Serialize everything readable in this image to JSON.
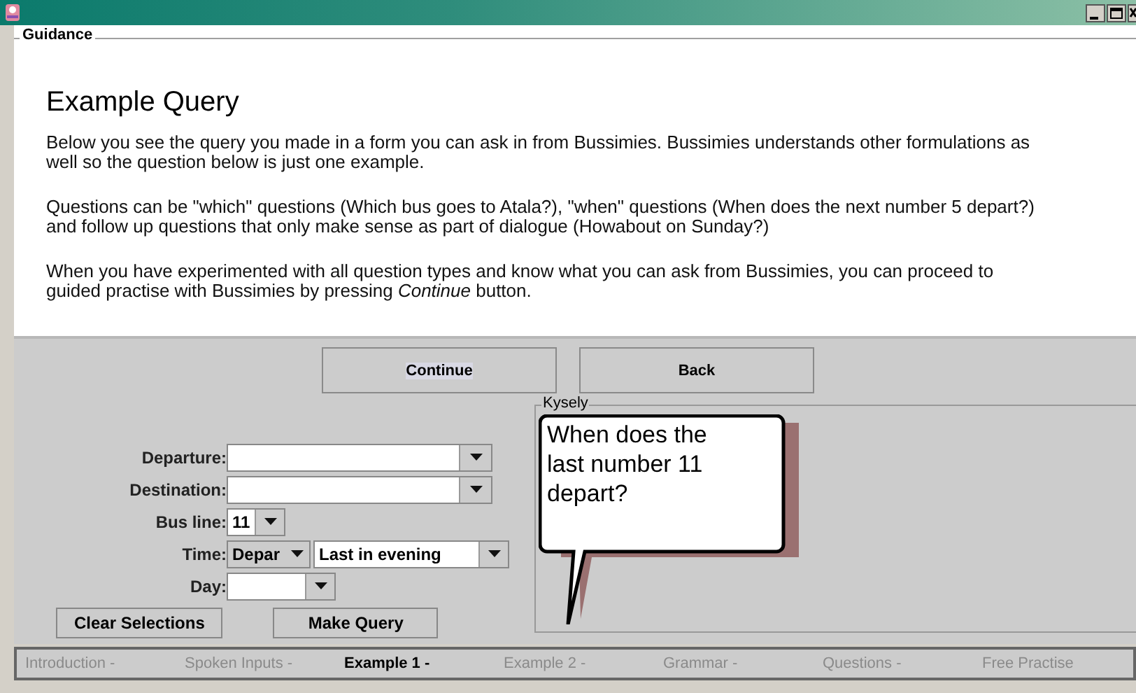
{
  "guidance": {
    "title": "Guidance",
    "heading": "Example Query",
    "paragraphs": [
      "Below you see the query you made in a form you can ask in from Bussimies. Bussimies understands other formulations as well so the question below is just one example.",
      "Questions can be \"which\" questions (Which bus goes to Atala?), \"when\" questions (When does the next number 5 depart?) and follow up questions that only make sense as part of dialogue (Howabout on Sunday?)",
      "When you have experimented with all question types and know what you can ask from Bussimies, you can proceed to guided practise with Bussimies by pressing *Continue* button."
    ]
  },
  "nav_buttons": [
    "Continue",
    "Back"
  ],
  "form": {
    "rows": [
      {
        "label": "Departure:",
        "fields": [
          {
            "kind": "combo"
          }
        ]
      },
      {
        "label": "Destination:",
        "fields": [
          {
            "kind": "combo"
          }
        ]
      },
      {
        "label": "Bus line:",
        "fields": [
          {
            "kind": "combo",
            "value": "11"
          }
        ]
      },
      {
        "label": "Time:",
        "fields": [
          {
            "kind": "combo",
            "value": "Depar"
          },
          {
            "kind": "combo",
            "value": "Last in evening"
          }
        ]
      },
      {
        "label": "Day:",
        "fields": [
          {
            "kind": "combo"
          }
        ]
      }
    ],
    "buttons": [
      "Clear Selections",
      "Make Query"
    ]
  },
  "query_panel": {
    "title": "Kysely",
    "bubble_text": "When does the last number 11 depart?"
  },
  "steps": [
    {
      "label": "Introduction -",
      "selected": false
    },
    {
      "label": "Spoken Inputs -",
      "selected": false
    },
    {
      "label": "Example 1 -",
      "selected": true
    },
    {
      "label": "Example 2 -",
      "selected": false
    },
    {
      "label": "Grammar -",
      "selected": false
    },
    {
      "label": "Questions -",
      "selected": false
    },
    {
      "label": "Free Practise",
      "selected": false
    }
  ]
}
